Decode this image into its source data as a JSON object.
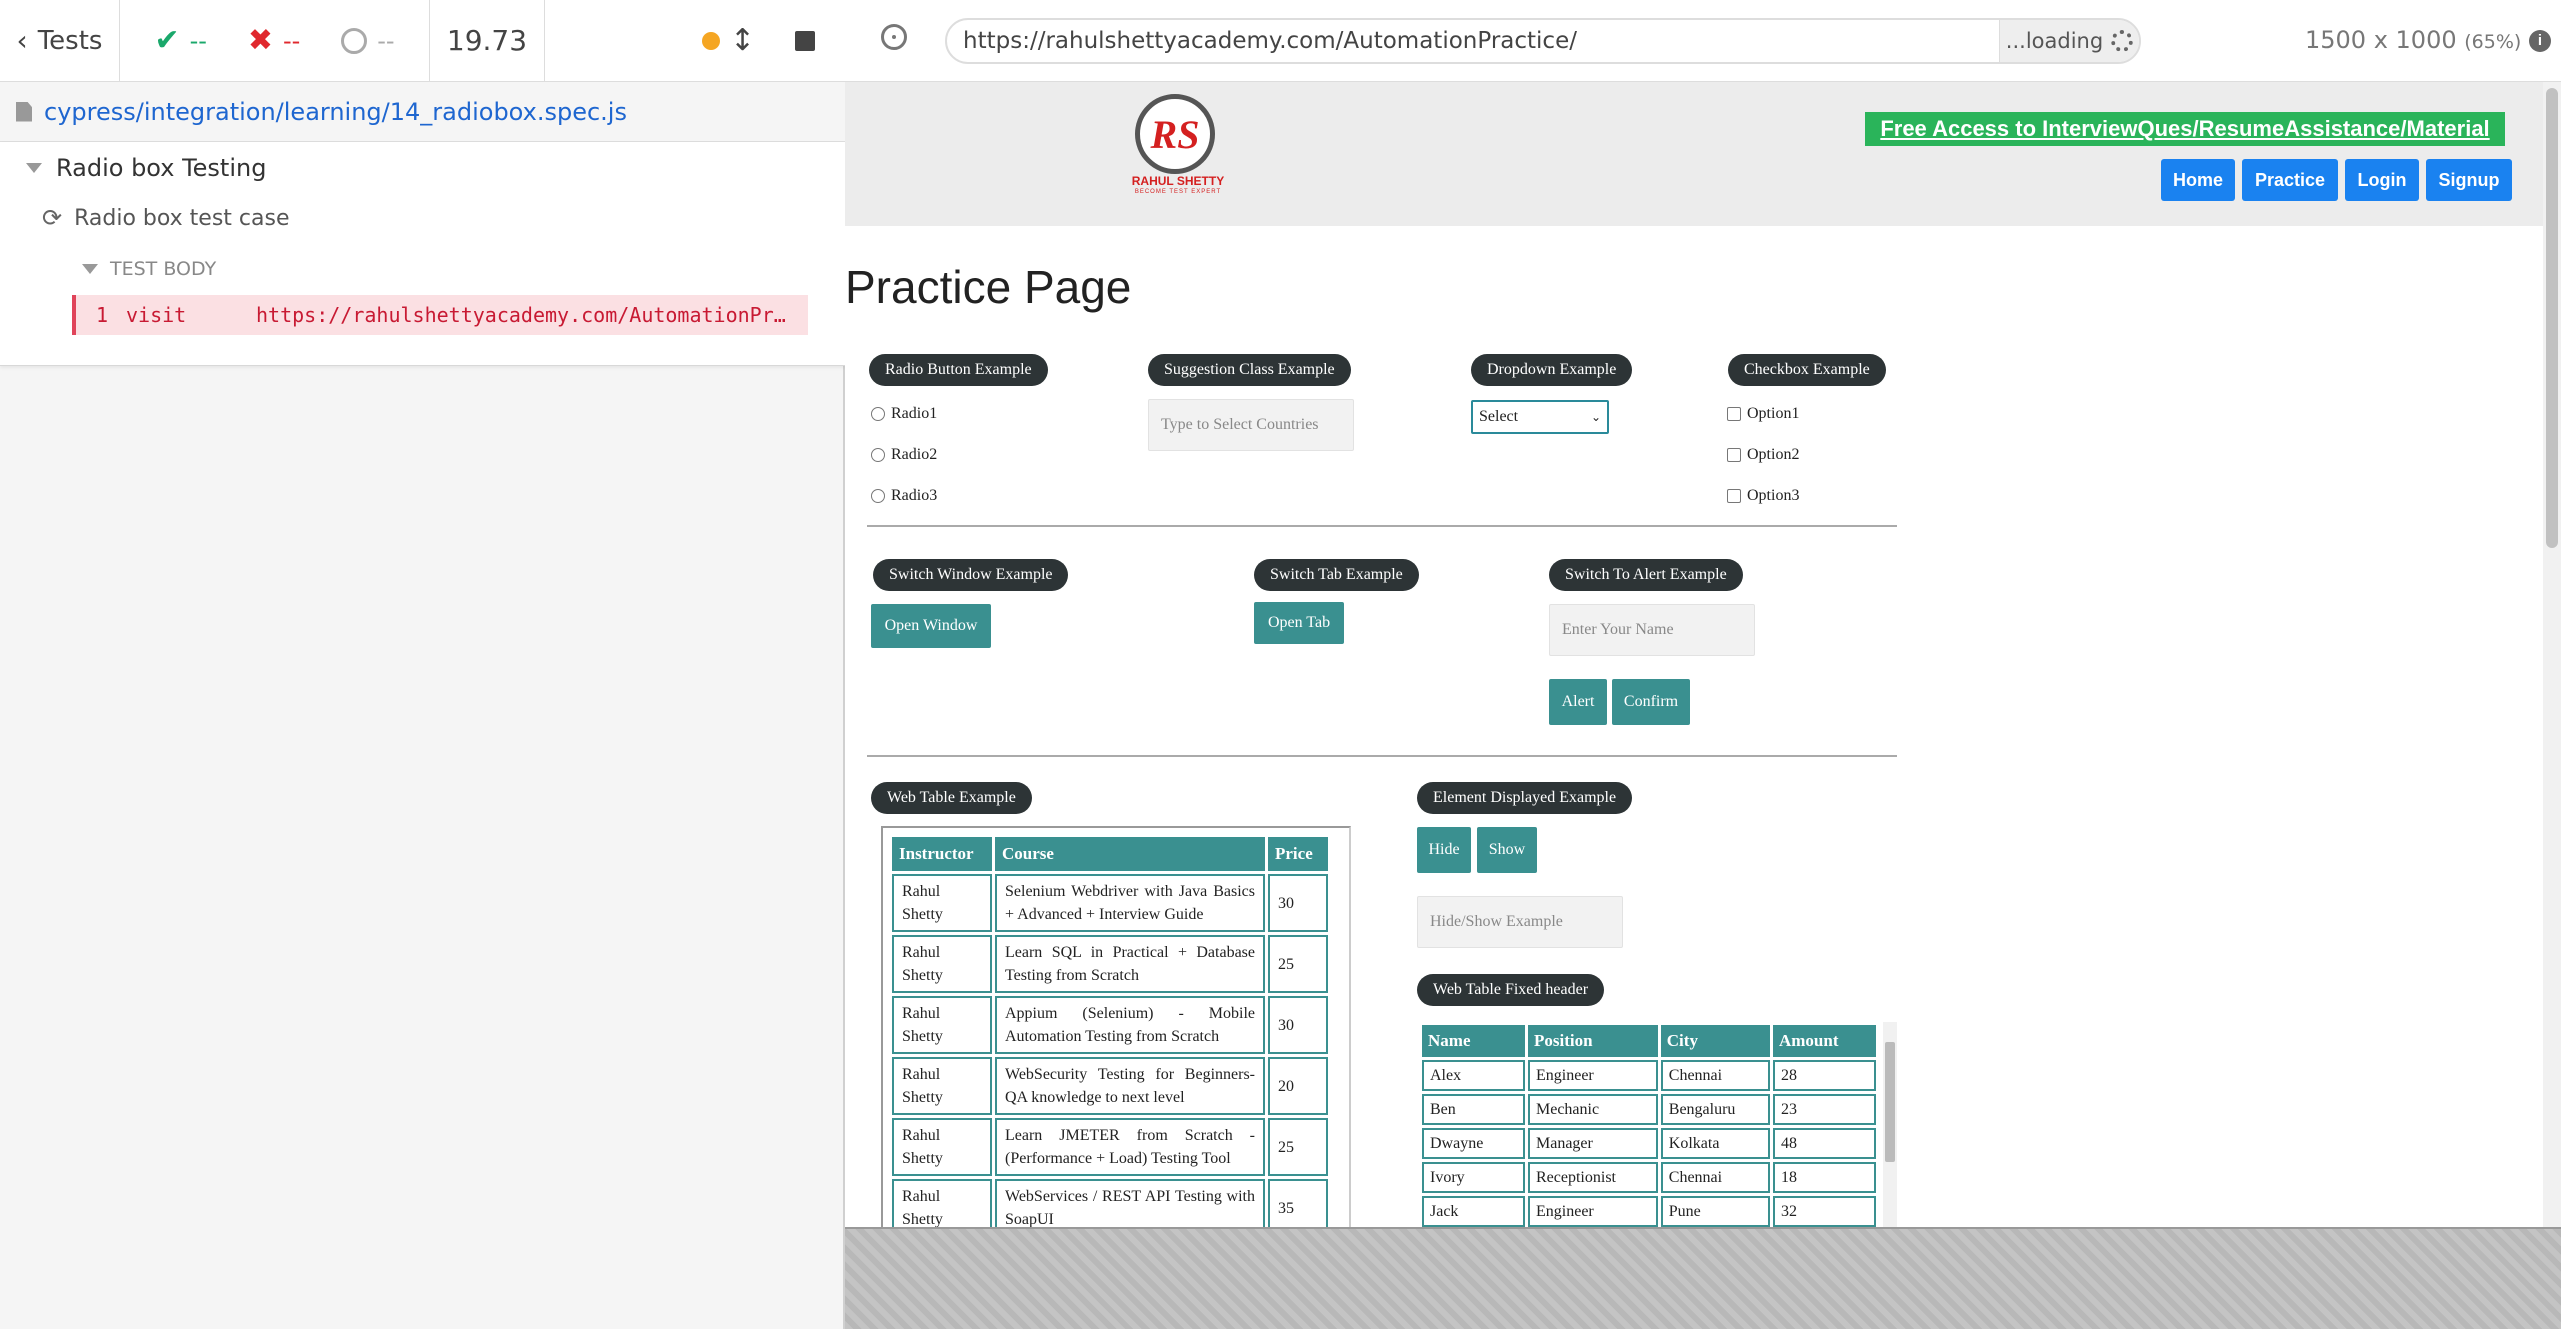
{
  "reporter": {
    "back_label": "Tests",
    "passed": "--",
    "failed": "--",
    "pending": "--",
    "duration": "19.73",
    "spec_path": "cypress/integration/learning/14_radiobox.spec.js",
    "suite_title": "Radio box Testing",
    "test_title": "Radio box test case",
    "body_label": "TEST BODY",
    "command": {
      "number": "1",
      "name": "visit",
      "message": "https://rahulshettyacademy.com/AutomationPractice/"
    }
  },
  "browser": {
    "url": "https://rahulshettyacademy.com/AutomationPractice/",
    "loading_label": "...loading",
    "viewport": "1500 x 1000",
    "zoom": "(65%)"
  },
  "site": {
    "logo_text": "RS",
    "logo_name": "RAHUL SHETTY",
    "logo_tagline": "BECOME TEST EXPERT",
    "free_access": "Free Access to InterviewQues/ResumeAssistance/Material",
    "nav": [
      "Home",
      "Practice",
      "Login",
      "Signup"
    ],
    "page_title": "Practice Page",
    "radio": {
      "title": "Radio Button Example",
      "options": [
        "Radio1",
        "Radio2",
        "Radio3"
      ]
    },
    "suggestion": {
      "title": "Suggestion Class Example",
      "placeholder": "Type to Select Countries"
    },
    "dropdown": {
      "title": "Dropdown Example",
      "selected": "Select"
    },
    "checkbox": {
      "title": "Checkbox Example",
      "options": [
        "Option1",
        "Option2",
        "Option3"
      ]
    },
    "switch_window": {
      "title": "Switch Window Example",
      "button": "Open Window"
    },
    "switch_tab": {
      "title": "Switch Tab Example",
      "button": "Open Tab"
    },
    "alert": {
      "title": "Switch To Alert Example",
      "placeholder": "Enter Your Name",
      "alert_btn": "Alert",
      "confirm_btn": "Confirm"
    },
    "web_table": {
      "title": "Web Table Example",
      "headers": [
        "Instructor",
        "Course",
        "Price"
      ],
      "rows": [
        [
          "Rahul Shetty",
          "Selenium Webdriver with Java Basics + Advanced + Interview Guide",
          "30"
        ],
        [
          "Rahul Shetty",
          "Learn SQL in Practical + Database Testing from Scratch",
          "25"
        ],
        [
          "Rahul Shetty",
          "Appium (Selenium) - Mobile Automation Testing from Scratch",
          "30"
        ],
        [
          "Rahul Shetty",
          "WebSecurity Testing for Beginners-QA knowledge to next level",
          "20"
        ],
        [
          "Rahul Shetty",
          "Learn JMETER from Scratch - (Performance + Load) Testing Tool",
          "25"
        ],
        [
          "Rahul Shetty",
          "WebServices / REST API Testing with SoapUI",
          "35"
        ]
      ]
    },
    "element_displayed": {
      "title": "Element Displayed Example",
      "hide_btn": "Hide",
      "show_btn": "Show",
      "placeholder": "Hide/Show Example"
    },
    "fixed_table": {
      "title": "Web Table Fixed header",
      "headers": [
        "Name",
        "Position",
        "City",
        "Amount"
      ],
      "rows": [
        [
          "Alex",
          "Engineer",
          "Chennai",
          "28"
        ],
        [
          "Ben",
          "Mechanic",
          "Bengaluru",
          "23"
        ],
        [
          "Dwayne",
          "Manager",
          "Kolkata",
          "48"
        ],
        [
          "Ivory",
          "Receptionist",
          "Chennai",
          "18"
        ],
        [
          "Jack",
          "Engineer",
          "Pune",
          "32"
        ]
      ]
    }
  }
}
